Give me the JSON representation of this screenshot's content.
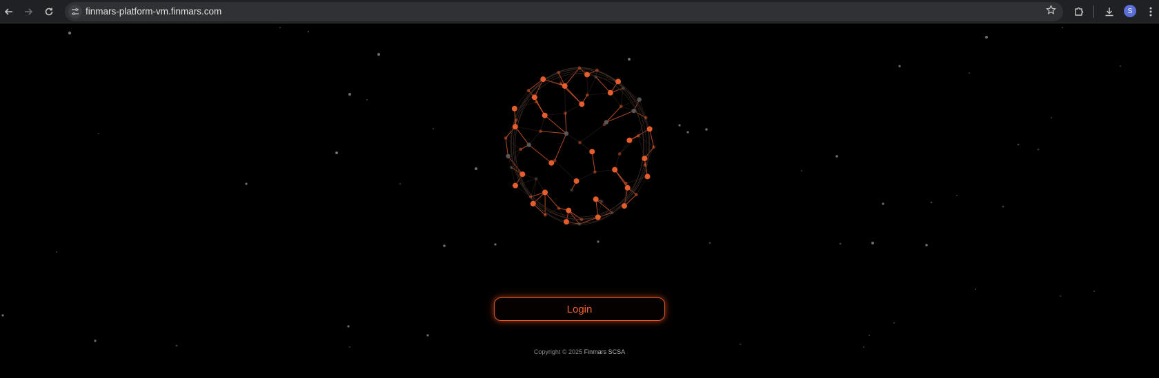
{
  "browser": {
    "url": "finmars-platform-vm.finmars.com",
    "profile_initial": "S",
    "icons": {
      "back": "arrow-left-icon",
      "forward": "arrow-right-icon",
      "reload": "reload-icon",
      "site_info": "tune-icon",
      "bookmark": "star-icon",
      "extensions": "puzzle-icon",
      "downloads": "download-icon",
      "menu": "kebab-menu-icon"
    }
  },
  "page": {
    "login_label": "Login",
    "footer": {
      "copyright": "Copyright ©",
      "year": "2025",
      "company": "Finmars SCSA"
    },
    "colors": {
      "accent": "#f0612d",
      "background": "#000000",
      "node_grey": "#5a5a5a"
    }
  }
}
